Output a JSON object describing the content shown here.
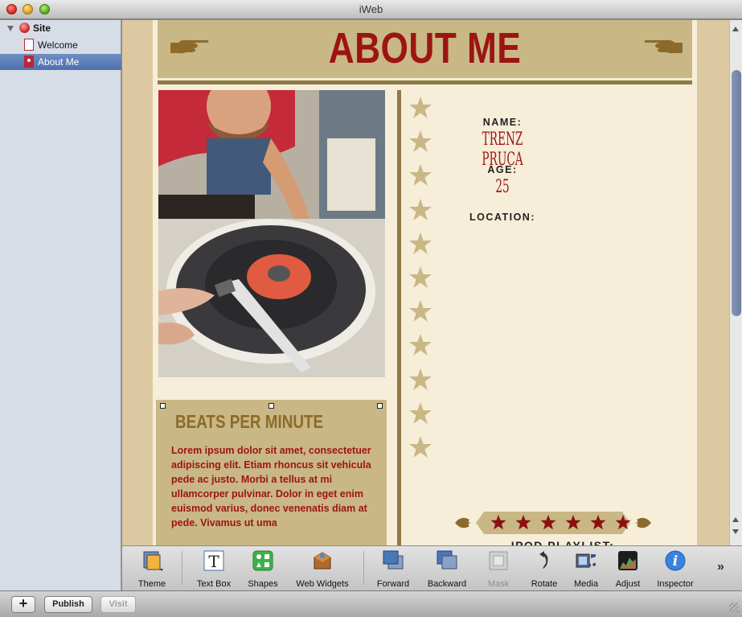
{
  "window": {
    "title": "iWeb"
  },
  "sidebar": {
    "site": {
      "label": "Site"
    },
    "pages": [
      {
        "label": "Welcome",
        "selected": false
      },
      {
        "label": "About Me",
        "selected": true
      }
    ]
  },
  "page": {
    "header_title": "ABOUT ME",
    "blurb": {
      "title": "BEATS PER MINUTE",
      "body": "Lorem ipsum dolor sit amet, consectetuer adipiscing elit. Etiam rhoncus sit vehicula pede ac justo. Morbi a tellus at mi ullamcorper pulvinar. Dolor in eget enim euismod varius, donec venenatis diam at pede. Vivamus ut uma"
    },
    "info": {
      "name_label": "NAME:",
      "name_value": "TRENZ PRUCA",
      "age_label": "AGE:",
      "age_value": "25",
      "location_label": "LOCATION:"
    },
    "playlist_heading": "IPOD PLAYLIST:"
  },
  "toolbar": {
    "buttons": [
      {
        "label": "Theme",
        "icon": "theme-icon"
      },
      {
        "label": "Text Box",
        "icon": "text-box-icon"
      },
      {
        "label": "Shapes",
        "icon": "shapes-icon"
      },
      {
        "label": "Web Widgets",
        "icon": "web-widgets-icon"
      },
      {
        "label": "Forward",
        "icon": "forward-icon"
      },
      {
        "label": "Backward",
        "icon": "backward-icon"
      },
      {
        "label": "Mask",
        "icon": "mask-icon",
        "disabled": true
      },
      {
        "label": "Rotate",
        "icon": "rotate-icon"
      },
      {
        "label": "Media",
        "icon": "media-icon"
      },
      {
        "label": "Adjust",
        "icon": "adjust-icon"
      },
      {
        "label": "Inspector",
        "icon": "inspector-icon"
      }
    ],
    "overflow": "»"
  },
  "bottombar": {
    "add": "+",
    "publish": "Publish",
    "visit": "Visit"
  },
  "colors": {
    "accent_red": "#9c1414",
    "tan": "#c9b785",
    "cream": "#f6eed9",
    "brown_rule": "#8f7a45",
    "sidebar_selected": "#4d6fad"
  }
}
